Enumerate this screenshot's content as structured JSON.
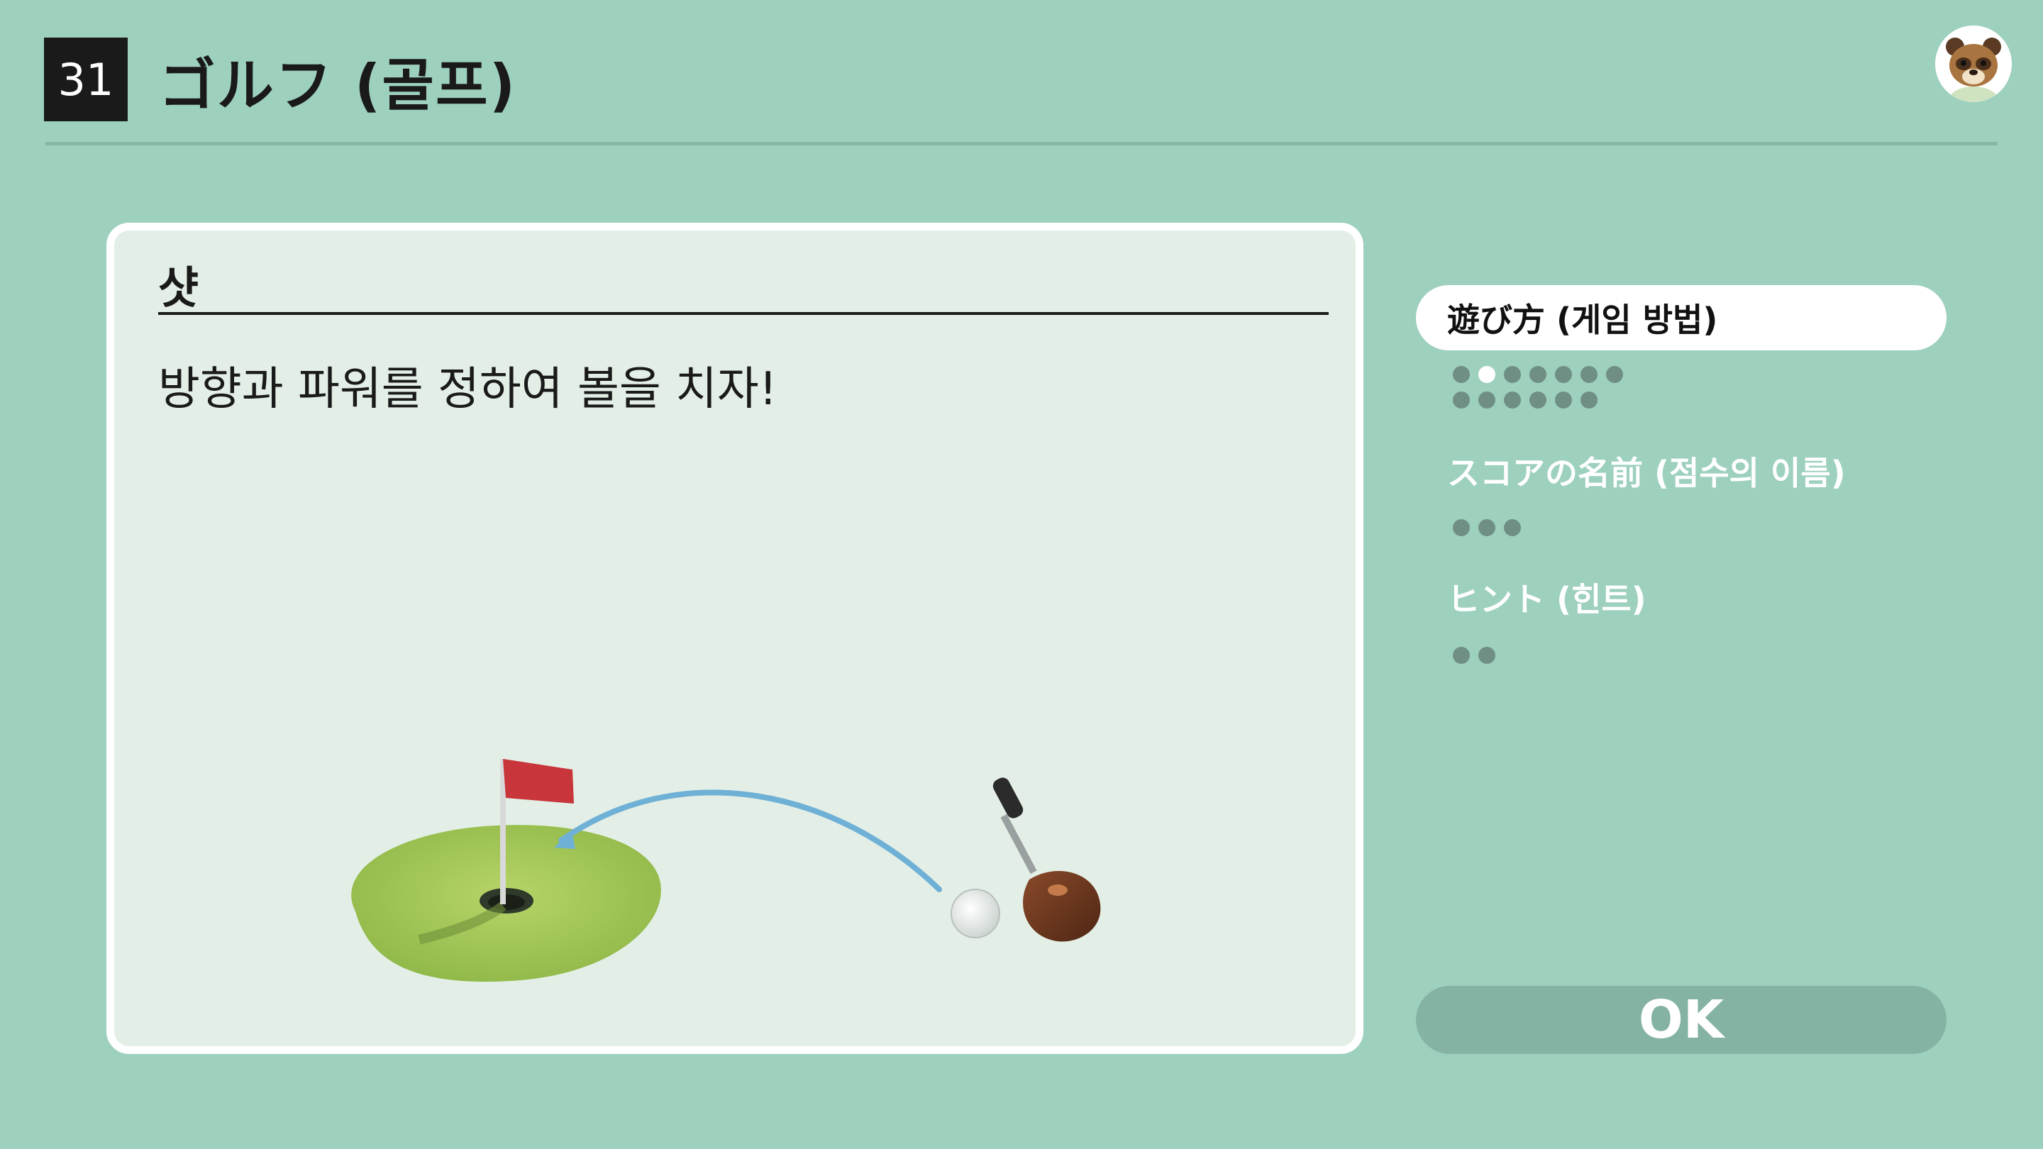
{
  "header": {
    "number": "31",
    "title": "ゴルフ (골프)"
  },
  "card": {
    "title": "샷",
    "description": "방향과 파워를 정하여 볼을 치자!"
  },
  "menu": {
    "items": [
      {
        "label": "遊び方 (게임 방법)",
        "active": true
      },
      {
        "label": "スコアの名前 (점수의 이름)",
        "active": false
      },
      {
        "label": "ヒント (힌트)",
        "active": false
      }
    ],
    "page_indicators": [
      {
        "section": "遊び方",
        "count": 13,
        "current": 2
      },
      {
        "section": "スコアの名前",
        "count": 3,
        "current": 0
      },
      {
        "section": "ヒント",
        "count": 2,
        "current": 0
      }
    ]
  },
  "ok_button": {
    "label": "OK"
  },
  "colors": {
    "background": "#9dd0bd",
    "card": "#e3efe6",
    "flag": "#c8353a",
    "green": "#a8cc5a",
    "arrow": "#6fb0d6"
  },
  "icons": {
    "avatar": "tom-nook-avatar-icon"
  }
}
